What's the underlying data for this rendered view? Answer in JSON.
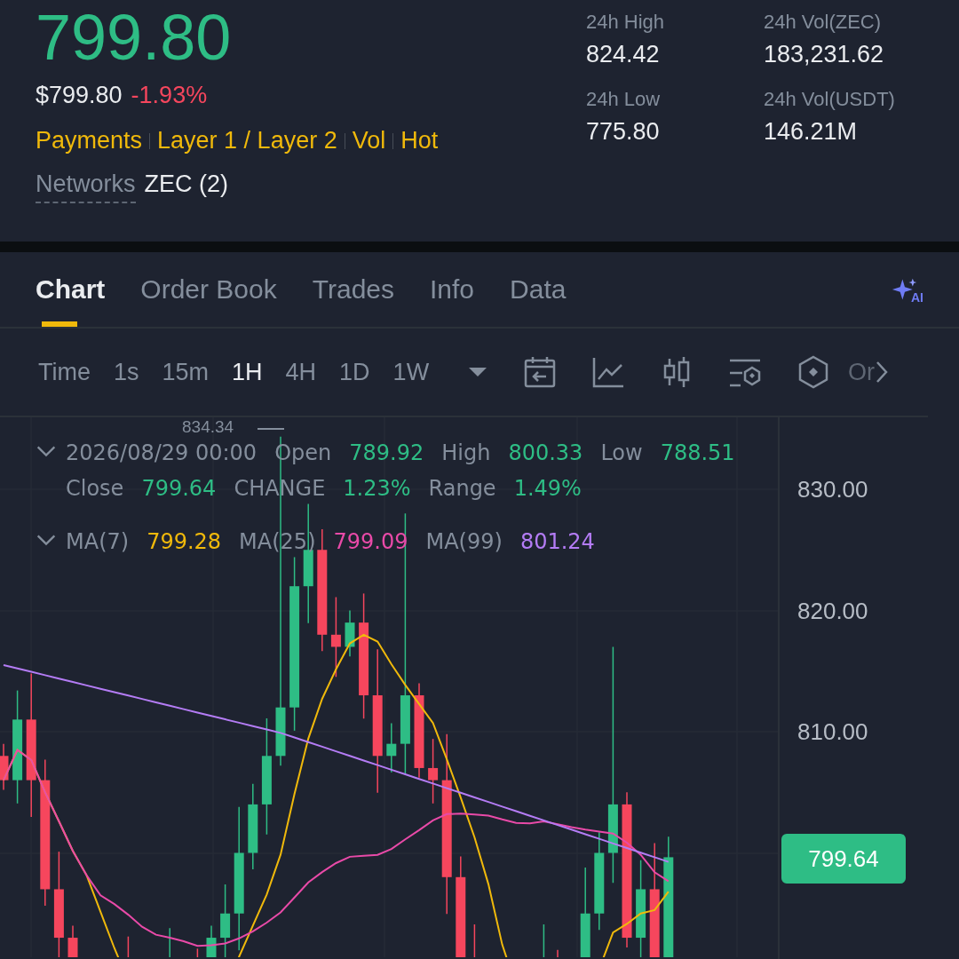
{
  "ticker": {
    "price": "799.80",
    "usd_price": "$799.80",
    "change": "-1.93%",
    "tags": [
      "Payments",
      "Layer 1 / Layer 2",
      "Vol",
      "Hot"
    ],
    "networks_label": "Networks",
    "networks_value": "ZEC (2)"
  },
  "stats": [
    {
      "label": "24h High",
      "value": "824.42"
    },
    {
      "label": "24h Vol(ZEC)",
      "value": "183,231.62"
    },
    {
      "label": "24h Low",
      "value": "775.80"
    },
    {
      "label": "24h Vol(USDT)",
      "value": "146.21M"
    }
  ],
  "tabs": [
    {
      "label": "Chart",
      "selected": true
    },
    {
      "label": "Order Book",
      "selected": false
    },
    {
      "label": "Trades",
      "selected": false
    },
    {
      "label": "Info",
      "selected": false
    },
    {
      "label": "Data",
      "selected": false
    }
  ],
  "intervals": [
    {
      "label": "Time",
      "selected": false
    },
    {
      "label": "1s",
      "selected": false
    },
    {
      "label": "15m",
      "selected": false
    },
    {
      "label": "1H",
      "selected": true
    },
    {
      "label": "4H",
      "selected": false
    },
    {
      "label": "1D",
      "selected": false
    },
    {
      "label": "1W",
      "selected": false
    }
  ],
  "ai_badge": "AI",
  "toolbar_more": "Or",
  "legend": {
    "date": "2026/08/29 00:00",
    "items": [
      {
        "label": "Open",
        "value": "789.92"
      },
      {
        "label": "High",
        "value": "800.33"
      },
      {
        "label": "Low",
        "value": "788.51"
      },
      {
        "label": "Close",
        "value": "799.64"
      },
      {
        "label": "CHANGE",
        "value": "1.23%"
      },
      {
        "label": "Range",
        "value": "1.49%"
      }
    ]
  },
  "moving_averages": [
    {
      "label": "MA(7)",
      "value": "799.28",
      "color": "#f0b90b"
    },
    {
      "label": "MA(25)",
      "value": "799.09",
      "color": "#e94aa8"
    },
    {
      "label": "MA(99)",
      "value": "801.24",
      "color": "#b47cf5"
    }
  ],
  "chart": {
    "high_marker": "834.34",
    "y_labels": [
      "830.00",
      "820.00",
      "810.00"
    ],
    "last_price": "799.64"
  }
}
